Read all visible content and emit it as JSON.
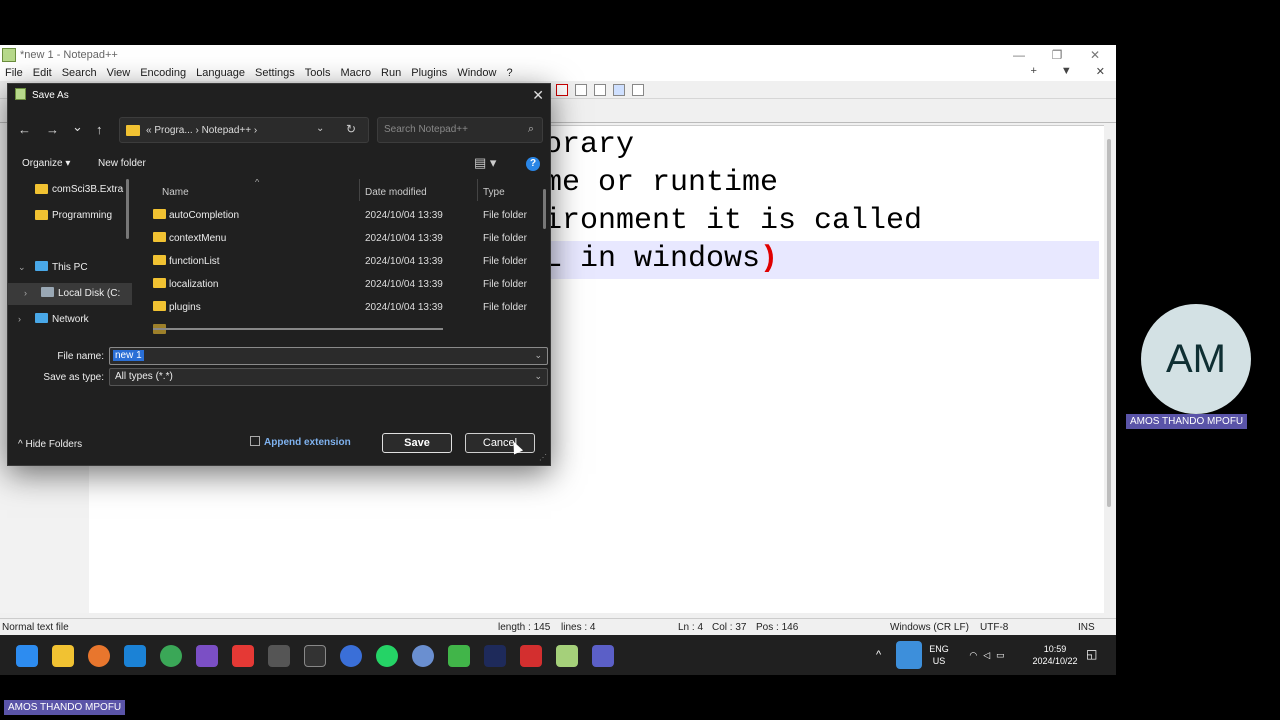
{
  "npp": {
    "title": "*new 1 - Notepad++",
    "minimize": "—",
    "maximize": "❐",
    "close": "✕",
    "menu": [
      "File",
      "Edit",
      "Search",
      "View",
      "Encoding",
      "Language",
      "Settings",
      "Tools",
      "Macro",
      "Run",
      "Plugins",
      "Window",
      "?"
    ],
    "menu_right": [
      "+",
      "▼",
      "✕"
    ],
    "editor_lines": [
      "orary",
      "me or runtime",
      "ironment it is called",
      "L in windows"
    ],
    "closing_paren": ")",
    "status": {
      "file_type": "Normal text file",
      "length": "length : 145",
      "lines": "lines : 4",
      "ln": "Ln : 4",
      "col": "Col : 37",
      "pos": "Pos : 146",
      "eol": "Windows (CR LF)",
      "encoding": "UTF-8",
      "mode": "INS"
    }
  },
  "dialog": {
    "title": "Save As",
    "close": "✕",
    "nav": {
      "back": "←",
      "forward": "→",
      "recent": "⌄",
      "up": "↑"
    },
    "address": {
      "crumbs": "«  Progra...  ›  Notepad++  ›",
      "dropdown": "⌄",
      "refresh": "↻"
    },
    "search_placeholder": "Search Notepad++",
    "search_icon": "⌕",
    "organize": "Organize ▾",
    "new_folder": "New folder",
    "view_icon": "▤ ▾",
    "help_icon": "?",
    "nav_pane": [
      {
        "label": "comSci3B.Extra",
        "icon": "folder-icon"
      },
      {
        "label": "Programming",
        "icon": "folder-icon"
      },
      {
        "label": "This PC",
        "icon": "pc-icon",
        "chevron": "⌄"
      },
      {
        "label": "Local Disk (C:",
        "icon": "disk-icon",
        "chevron": "›"
      },
      {
        "label": "Network",
        "icon": "network-icon",
        "chevron": "›"
      }
    ],
    "columns": {
      "name": "Name",
      "date": "Date modified",
      "type": "Type",
      "sort": "^"
    },
    "files": [
      {
        "name": "autoCompletion",
        "date": "2024/10/04 13:39",
        "type": "File folder"
      },
      {
        "name": "contextMenu",
        "date": "2024/10/04 13:39",
        "type": "File folder"
      },
      {
        "name": "functionList",
        "date": "2024/10/04 13:39",
        "type": "File folder"
      },
      {
        "name": "localization",
        "date": "2024/10/04 13:39",
        "type": "File folder"
      },
      {
        "name": "plugins",
        "date": "2024/10/04 13:39",
        "type": "File folder"
      }
    ],
    "file_name_label": "File name:",
    "file_name_value": "new 1",
    "save_type_label": "Save as type:",
    "save_type_value": "All types (*.*)",
    "hide_folders": "^  Hide Folders",
    "append_extension": "Append extension",
    "save": "Save",
    "cancel": "Cancel"
  },
  "taskbar": {
    "lang": "ENG",
    "region": "US",
    "time": "10:59",
    "date": "2024/10/22"
  },
  "participant": {
    "initials": "AM",
    "name": "AMOS THANDO MPOFU"
  },
  "colors": {
    "accent": "#2a6fd6",
    "paren": "#e00000",
    "line_highlight": "#e8e8ff",
    "name_tag": "#5a54a8"
  }
}
